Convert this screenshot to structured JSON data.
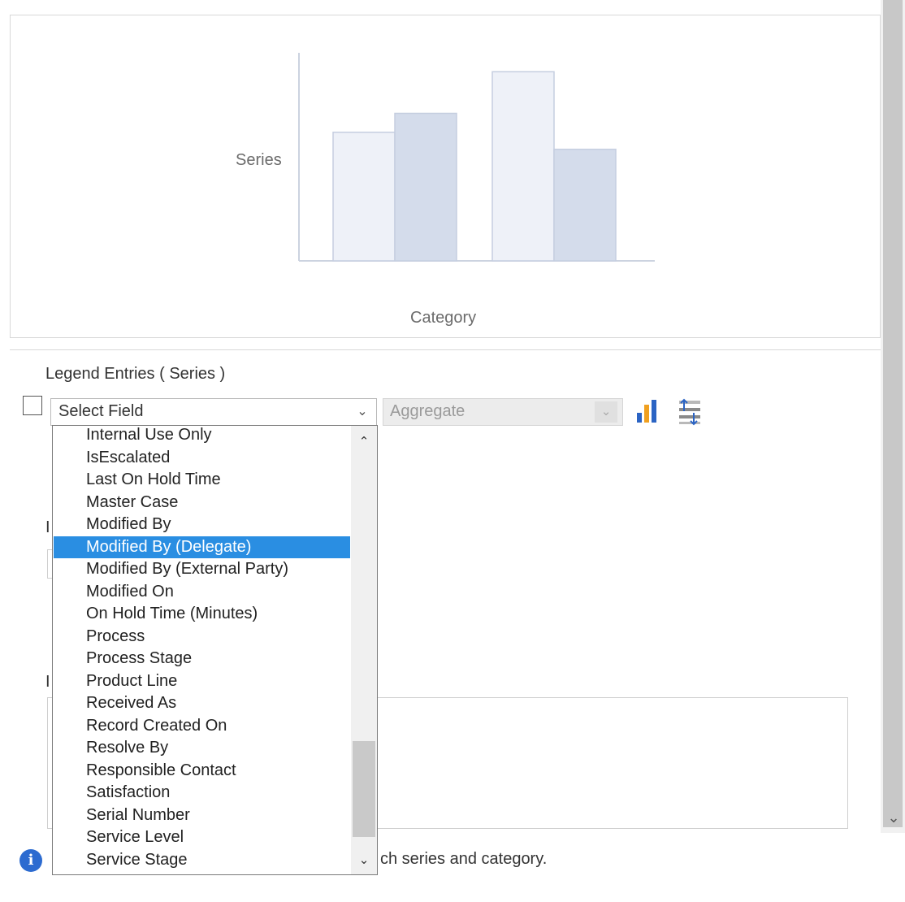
{
  "chart_preview": {
    "series_label": "Series",
    "category_label": "Category",
    "chart_data": {
      "type": "bar",
      "categories": [
        "",
        ""
      ],
      "series": [
        {
          "values": [
            68,
            100
          ]
        },
        {
          "values": [
            78,
            59
          ]
        }
      ],
      "ylim": [
        0,
        110
      ]
    }
  },
  "legend": {
    "title": "Legend Entries ( Series )",
    "field_select": {
      "value": "Select Field"
    },
    "aggregate_select": {
      "value": "Aggregate"
    }
  },
  "dropdown": {
    "items": [
      "Internal Use Only",
      "IsEscalated",
      "Last On Hold Time",
      "Master Case",
      "Modified By",
      "Modified By (Delegate)",
      "Modified By (External Party)",
      "Modified On",
      "On Hold Time (Minutes)",
      "Process",
      "Process Stage",
      "Product Line",
      "Received As",
      "Record Created On",
      "Resolve By",
      "Responsible Contact",
      "Satisfaction",
      "Serial Number",
      "Service Level",
      "Service Stage"
    ],
    "selected_index": 5
  },
  "background_letters": [
    "I",
    "I"
  ],
  "info": {
    "text_visible": "ch series and category."
  },
  "colors": {
    "selection": "#2a8ee2",
    "bar_light": "#eef1f8",
    "bar_dark": "#d4dceb",
    "info": "#2c6bd0"
  },
  "icons": {
    "bar_chart": "bar-chart-icon",
    "swap": "swap-rows-icon",
    "info": "info-icon"
  }
}
